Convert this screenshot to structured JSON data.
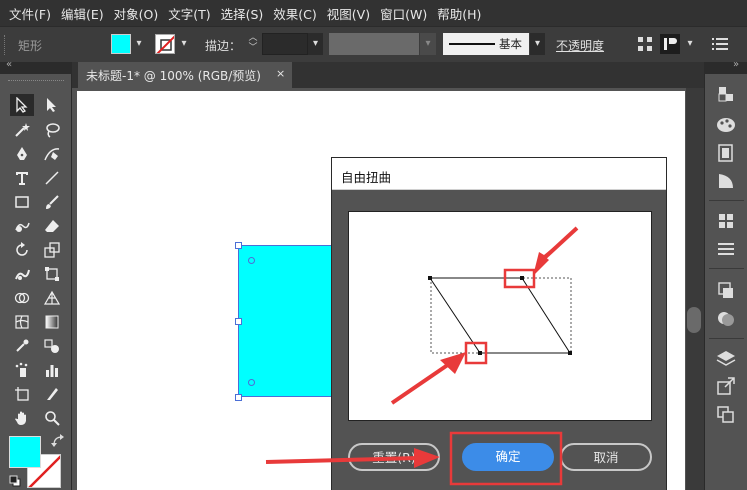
{
  "menubar": {
    "items": [
      "文件(F)",
      "编辑(E)",
      "对象(O)",
      "文字(T)",
      "选择(S)",
      "效果(C)",
      "视图(V)",
      "窗口(W)",
      "帮助(H)"
    ]
  },
  "controlbar": {
    "object_label": "矩形",
    "stroke_label": "描边：",
    "brush_label": "基本",
    "opacity_label": "不透明度",
    "fill_color": "#00FFFF"
  },
  "document": {
    "tab_title": "未标题-1* @ 100% (RGB/预览)",
    "close_glyph": "×"
  },
  "dialog": {
    "title": "自由扭曲",
    "reset_label": "重置(R)",
    "ok_label": "确定",
    "cancel_label": "取消"
  },
  "colors": {
    "accent": "#3C8CE8",
    "annotation": "#E83A3A",
    "fill": "#00FFFF"
  },
  "icons": {
    "toolbar": [
      "selection-tool-icon",
      "direct-selection-tool-icon",
      "magic-wand-icon",
      "lasso-icon",
      "pen-icon",
      "curvature-icon",
      "type-icon",
      "line-icon",
      "rectangle-icon",
      "paintbrush-icon",
      "shaper-icon",
      "eraser-icon",
      "rotate-icon",
      "scale-icon",
      "warp-icon",
      "free-transform-icon",
      "shape-builder-icon",
      "perspective-grid-icon",
      "mesh-icon",
      "gradient-icon",
      "eyedropper-icon",
      "blend-icon",
      "symbol-sprayer-icon",
      "column-graph-icon",
      "artboard-icon",
      "slice-icon",
      "hand-icon",
      "zoom-icon"
    ],
    "dock": [
      "color-guide-icon",
      "color-icon",
      "swatches-icon",
      "brushes-icon",
      "symbols-icon",
      "stroke-icon",
      "gradient-panel-icon",
      "transparency-icon",
      "appearance-icon",
      "graphic-styles-icon",
      "layers-icon",
      "asset-export-icon",
      "artboards-icon"
    ]
  }
}
